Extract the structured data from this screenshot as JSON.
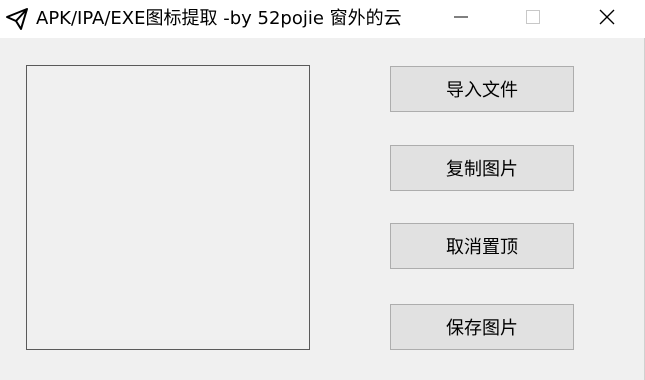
{
  "window": {
    "title": "APK/IPA/EXE图标提取  -by 52pojie 窗外的云",
    "app_icon": "paper-plane-icon",
    "controls": {
      "minimize_icon": "minimize-icon",
      "maximize_icon": "maximize-icon",
      "close_icon": "close-icon"
    }
  },
  "buttons": {
    "import_file": "导入文件",
    "copy_image": "复制图片",
    "cancel_topmost": "取消置顶",
    "save_image": "保存图片"
  }
}
